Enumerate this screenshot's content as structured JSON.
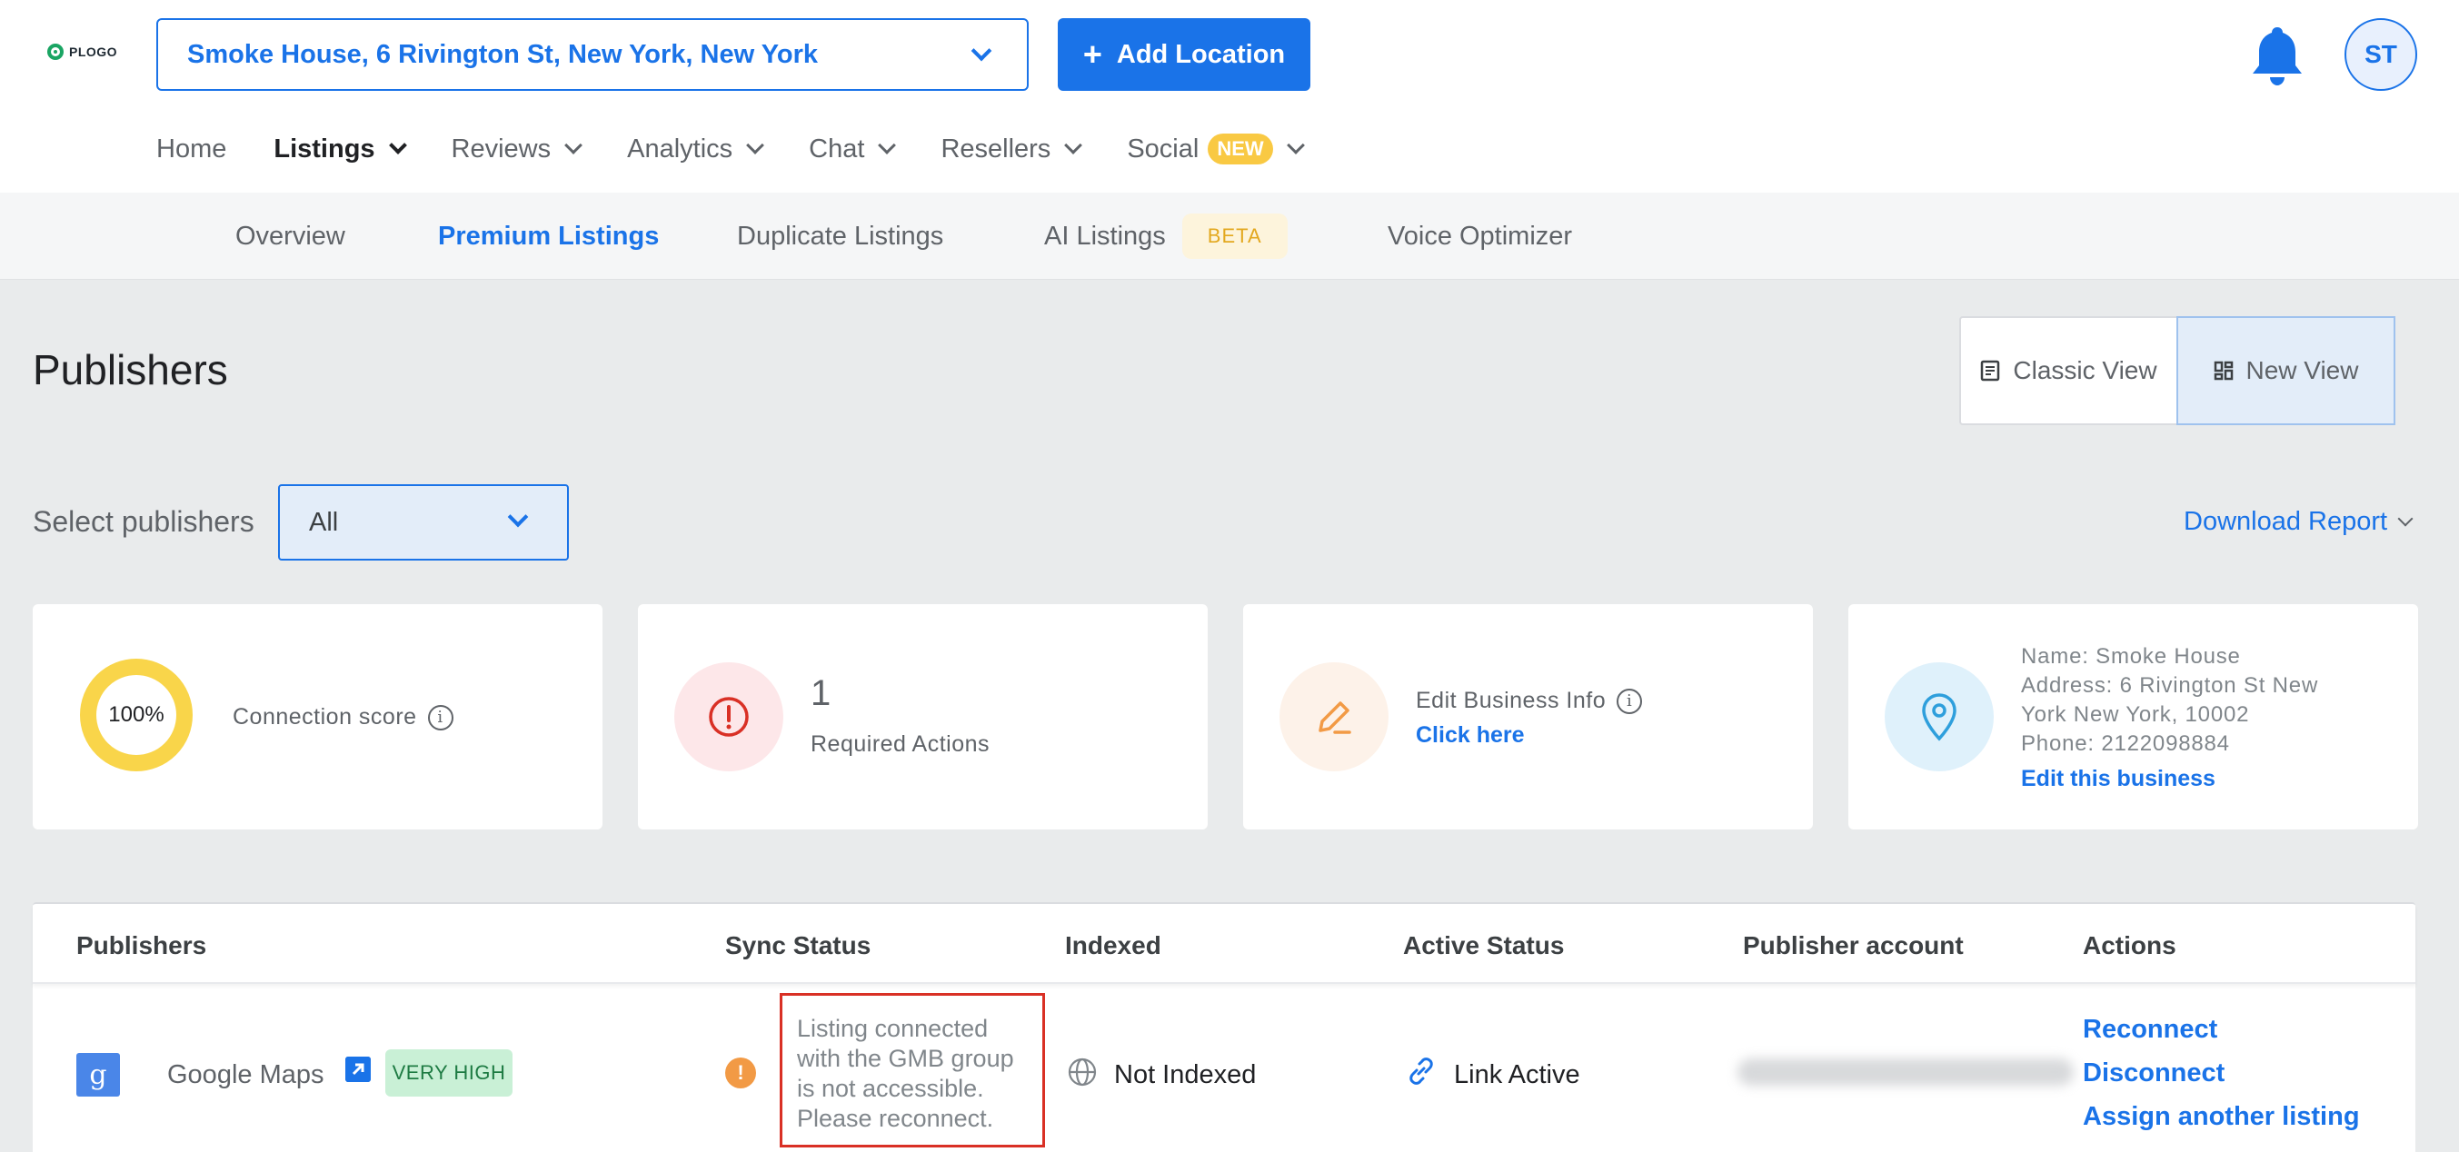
{
  "header": {
    "logo_text": "PLOGO",
    "location_select": "Smoke House, 6 Rivington St, New York, New York",
    "add_location_label": "Add Location",
    "avatar_initials": "ST"
  },
  "main_nav": {
    "items": [
      "Home",
      "Listings",
      "Reviews",
      "Analytics",
      "Chat",
      "Resellers",
      "Social"
    ],
    "active": "Listings",
    "social_badge": "NEW"
  },
  "sub_nav": {
    "items": [
      "Overview",
      "Premium Listings",
      "Duplicate Listings",
      "AI Listings",
      "Voice Optimizer"
    ],
    "active": "Premium Listings",
    "ai_badge": "BETA"
  },
  "page": {
    "title": "Publishers",
    "classic_view": "Classic View",
    "new_view": "New View",
    "active_view": "New View",
    "select_label": "Select publishers",
    "select_value": "All",
    "download_report": "Download Report"
  },
  "cards": {
    "connection": {
      "score": "100%",
      "score_value": 100,
      "label": "Connection score"
    },
    "actions": {
      "count": "1",
      "label": "Required Actions"
    },
    "edit": {
      "label": "Edit Business Info",
      "link": "Click here"
    },
    "business": {
      "name": "Name: Smoke House",
      "address_1": "Address: 6 Rivington St New",
      "address_2": "York New York, 10002",
      "phone": "Phone: 2122098884",
      "link": "Edit this business"
    }
  },
  "table": {
    "headers": [
      "Publishers",
      "Sync Status",
      "Indexed",
      "Active Status",
      "Publisher account",
      "Actions"
    ],
    "rows": [
      {
        "publisher": "Google Maps",
        "badge": "VERY HIGH",
        "sync_lines": [
          "Listing connected",
          "with the GMB group",
          "is not accessible.",
          "Please reconnect."
        ],
        "indexed": "Not Indexed",
        "active_status": "Link Active",
        "actions": [
          "Reconnect",
          "Disconnect",
          "Assign another listing"
        ]
      }
    ]
  },
  "colors": {
    "primary": "#1a73e8",
    "background": "#e9ebec",
    "score_ring": "#f9d54a",
    "alert_red": "#d93025",
    "warning_orange": "#f29a45",
    "badge_green": "#c9f0d6"
  }
}
